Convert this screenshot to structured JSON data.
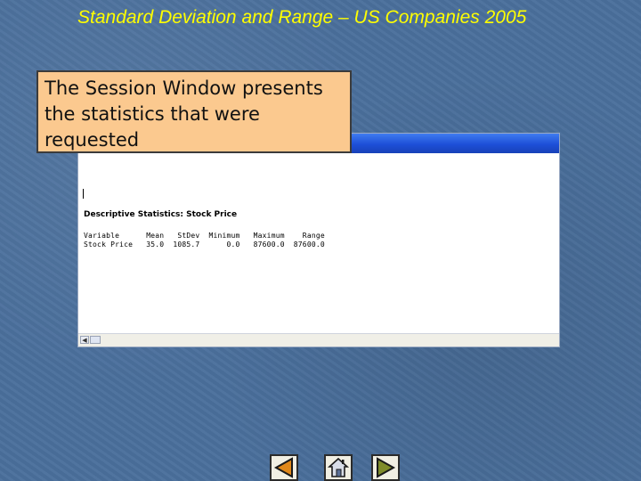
{
  "slide": {
    "title": "Standard Deviation and Range – US Companies 2005"
  },
  "callout": {
    "text": "The Session Window presents the statistics that were requested"
  },
  "session_window": {
    "heading": "Descriptive Statistics: Stock Price",
    "columns": [
      "Variable",
      "Mean",
      "StDev",
      "Minimum",
      "Maximum",
      "Range"
    ],
    "rows": [
      {
        "Variable": "Stock Price",
        "Mean": "35.0",
        "StDev": "1085.7",
        "Minimum": "0.0",
        "Maximum": "87600.0",
        "Range": "87600.0"
      }
    ],
    "header_line": "Variable      Mean   StDev  Minimum   Maximum    Range",
    "data_line": "Stock Price   35.0  1085.7      0.0   87600.0  87600.0"
  },
  "nav": {
    "prev_icon": "left-triangle-icon",
    "home_icon": "home-icon",
    "next_icon": "right-triangle-icon"
  },
  "colors": {
    "background": "#4a6f9c",
    "title": "#ffff00",
    "callout_fill": "#fbc98f",
    "titlebar": "#1d4fd8",
    "nav_prev_fill": "#e0881a",
    "nav_next_fill": "#7f8c2a"
  }
}
